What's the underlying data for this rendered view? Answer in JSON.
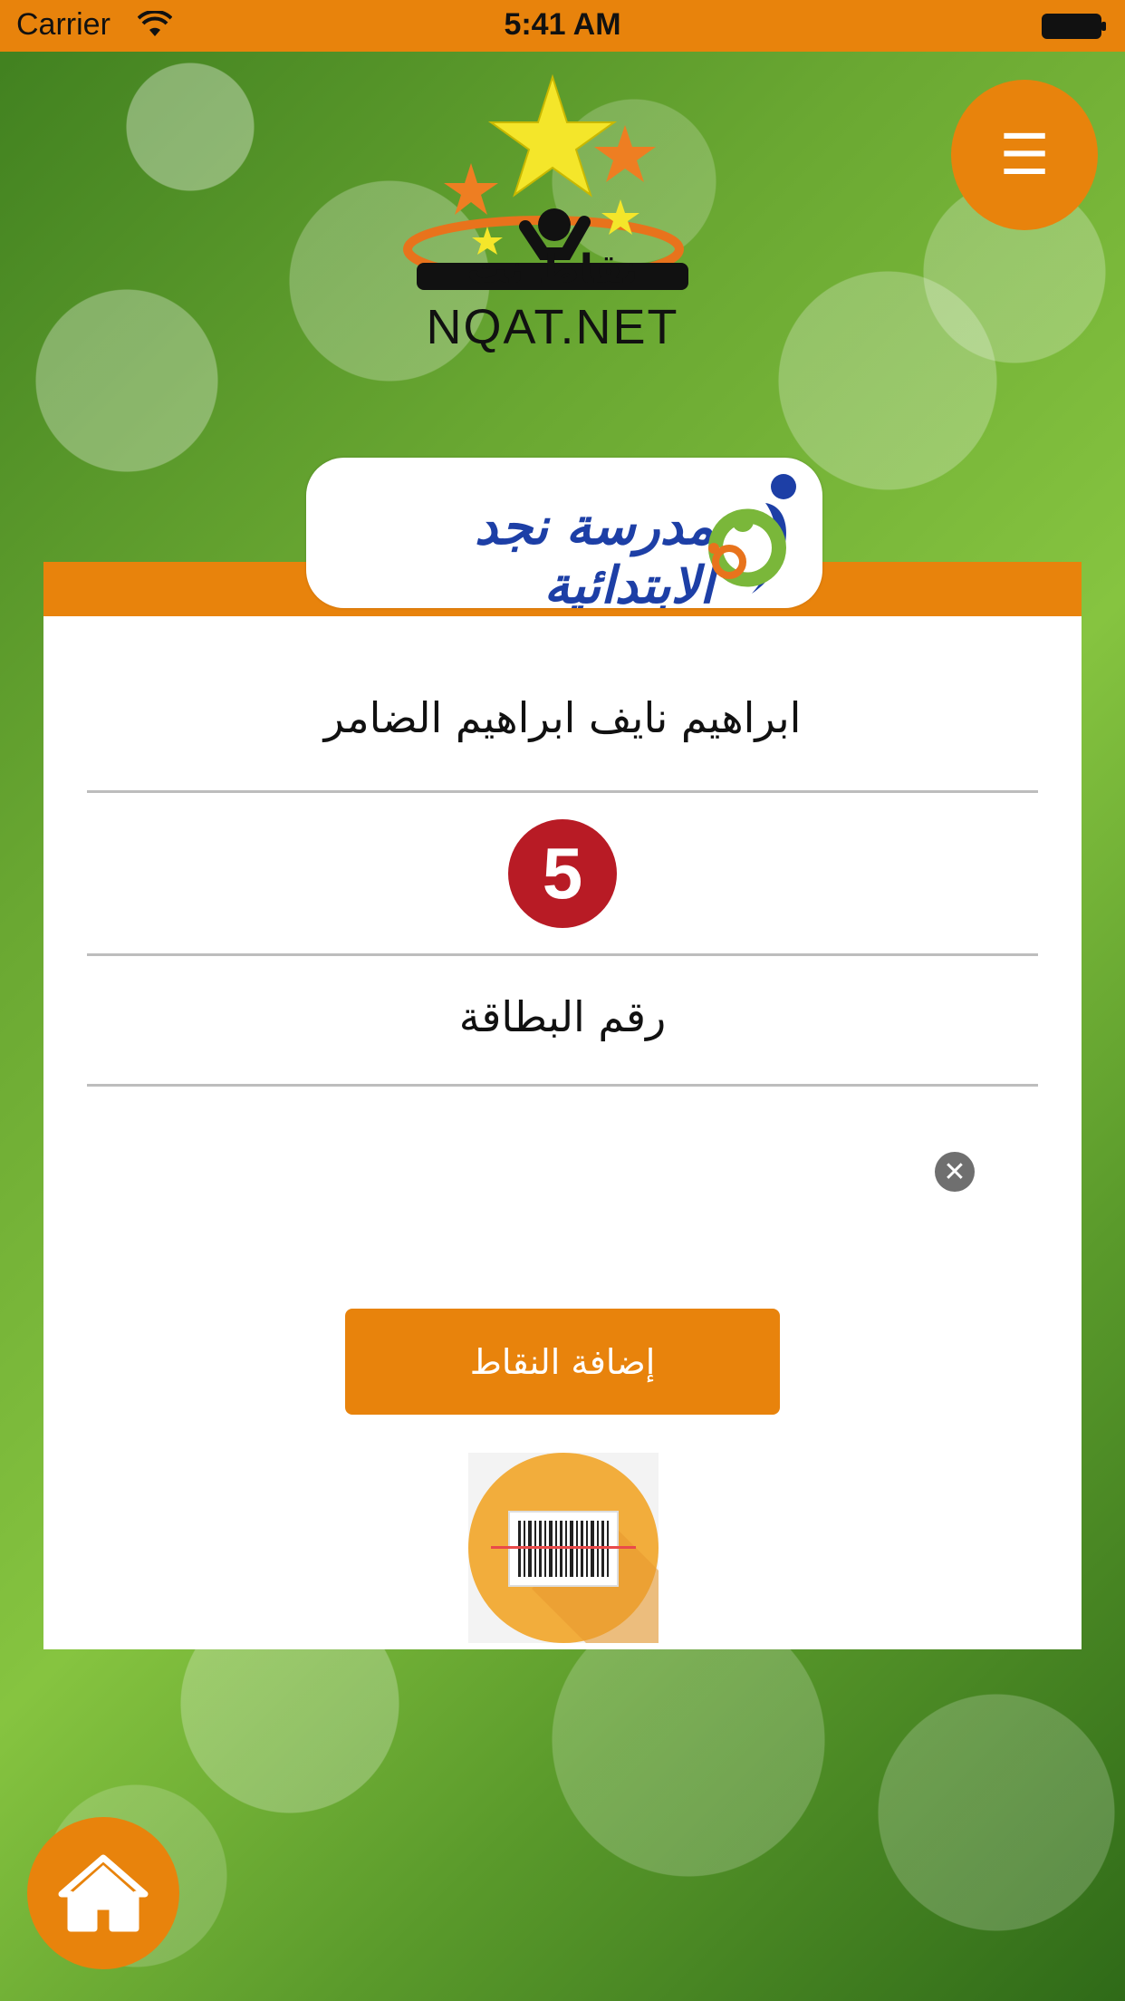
{
  "status_bar": {
    "carrier": "Carrier",
    "time": "5:41 AM"
  },
  "header": {
    "menu_icon": "hamburger-icon",
    "logo_text": "NQAT.NET",
    "logo_arabic": "نقاط نت"
  },
  "school": {
    "name": "مدرسة نجد الابتدائية",
    "logo_icon": "family-logo-icon"
  },
  "student": {
    "name": "ابراهيم نايف ابراهيم الضامر",
    "points": "5"
  },
  "card_number": {
    "label": "رقم البطاقة",
    "value": "",
    "placeholder": ""
  },
  "actions": {
    "add_points_label": "إضافة النقاط",
    "scan_icon": "barcode-scan-icon",
    "home_icon": "home-icon"
  },
  "colors": {
    "accent": "#e8830c",
    "points_badge": "#b81b25",
    "school_blue": "#1d3fa6"
  }
}
